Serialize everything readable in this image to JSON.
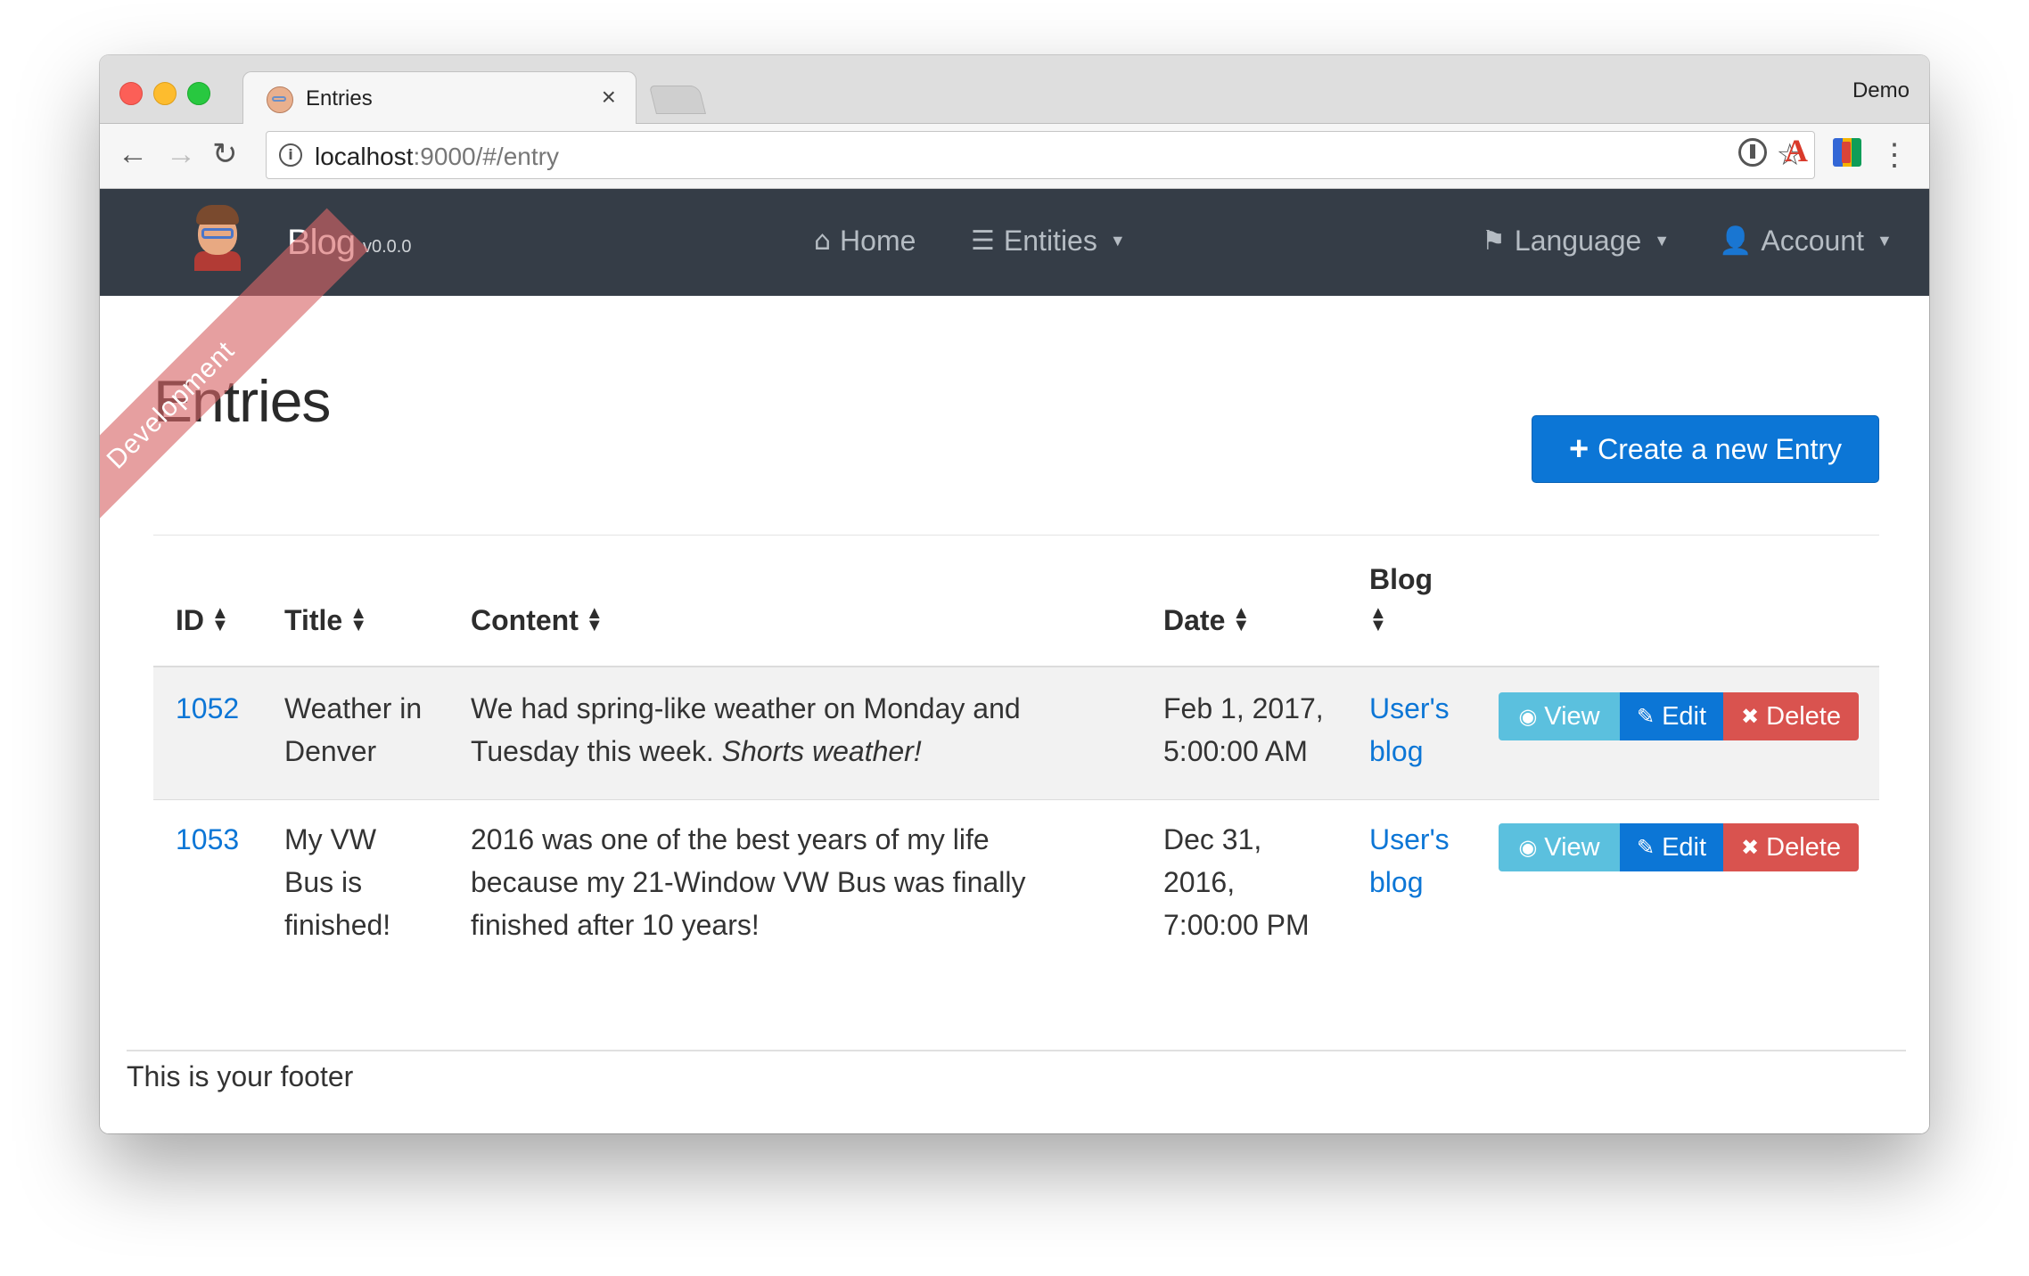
{
  "browser": {
    "tab_title": "Entries",
    "tab_close": "×",
    "profile": "Demo",
    "url_host": "localhost",
    "url_rest": ":9000/#/entry",
    "icons": {
      "back": "arrow-left-icon",
      "forward": "arrow-right-icon",
      "reload": "reload-icon",
      "info": "info-icon",
      "star": "star-icon",
      "menu": "kebab-menu-icon"
    }
  },
  "navbar": {
    "brand": "Blog",
    "version": "v0.0.0",
    "ribbon": "Development",
    "links": [
      {
        "label": "Home",
        "icon": "home-icon"
      },
      {
        "label": "Entities",
        "icon": "list-icon"
      },
      {
        "label": "Language",
        "icon": "flag-icon"
      },
      {
        "label": "Account",
        "icon": "user-icon"
      }
    ]
  },
  "main": {
    "title": "Entries",
    "create_button": "Create a new Entry"
  },
  "table": {
    "columns": [
      "ID",
      "Title",
      "Content",
      "Date",
      "Blog"
    ],
    "rows": [
      {
        "id": "1052",
        "title_lines": [
          "Weather in",
          "Denver"
        ],
        "content_line1": "We had spring-like weather on Monday and",
        "content_line2_plain": "Tuesday this week. ",
        "content_line2_em": "Shorts weather!",
        "date_lines": [
          "Feb 1, 2017,",
          "5:00:00 AM"
        ],
        "blog_lines": [
          "User's",
          "blog"
        ]
      },
      {
        "id": "1053",
        "title_lines": [
          "My VW",
          "Bus is",
          "finished!"
        ],
        "content_lines": [
          "2016 was one of the best years of my life",
          "because my 21-Window VW Bus was finally",
          "finished after 10 years!"
        ],
        "date_lines": [
          "Dec 31,",
          "2016,",
          "7:00:00 PM"
        ],
        "blog_lines": [
          "User's",
          "blog"
        ]
      }
    ],
    "actions": {
      "view": "View",
      "edit": "Edit",
      "delete": "Delete"
    }
  },
  "footer": {
    "text": "This is your footer"
  },
  "colors": {
    "navbar": "#353d47",
    "primary": "#0c76d6",
    "info": "#5bc0de",
    "danger": "#d9534f",
    "ribbon": "#d66466"
  }
}
